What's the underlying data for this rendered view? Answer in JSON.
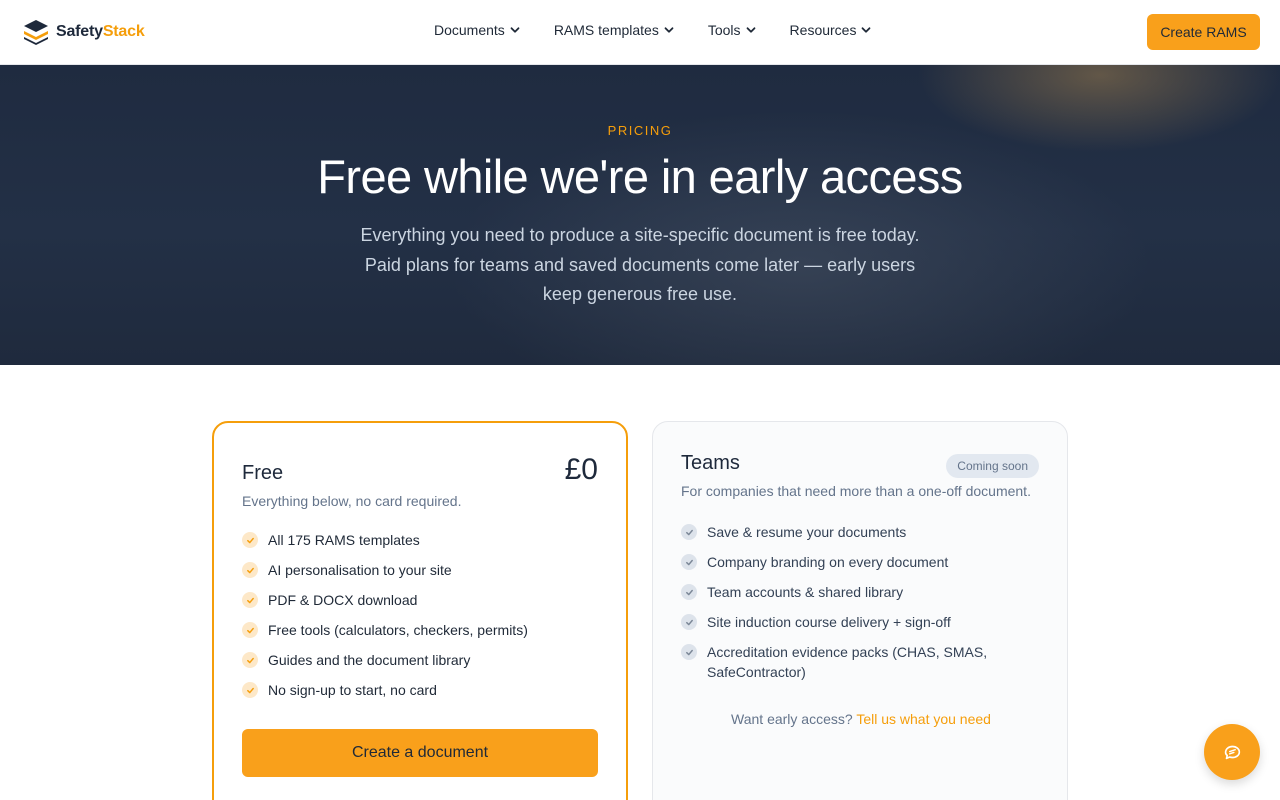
{
  "brand": {
    "name_part1": "Safety",
    "name_part2": "Stack"
  },
  "nav": {
    "items": [
      {
        "label": "Documents"
      },
      {
        "label": "RAMS templates"
      },
      {
        "label": "Tools"
      },
      {
        "label": "Resources"
      }
    ],
    "cta_label": "Create RAMS"
  },
  "hero": {
    "eyebrow": "PRICING",
    "title": "Free while we're in early access",
    "subtitle": "Everything you need to produce a site-specific document is free today. Paid plans for teams and saved documents come later — early users keep generous free use."
  },
  "plans": {
    "free": {
      "name": "Free",
      "price": "£0",
      "description": "Everything below, no card required.",
      "features": [
        "All 175 RAMS templates",
        "AI personalisation to your site",
        "PDF & DOCX download",
        "Free tools (calculators, checkers, permits)",
        "Guides and the document library",
        "No sign-up to start, no card"
      ],
      "button_label": "Create a document"
    },
    "teams": {
      "name": "Teams",
      "badge": "Coming soon",
      "description": "For companies that need more than a one-off document.",
      "features": [
        "Save & resume your documents",
        "Company branding on every document",
        "Team accounts & shared library",
        "Site induction course delivery + sign-off",
        "Accreditation evidence packs (CHAS, SMAS, SafeContractor)"
      ],
      "early_access_text": "Want early access?",
      "early_access_link": "Tell us what you need"
    }
  },
  "colors": {
    "accent": "#f9a01b",
    "hero_bg": "#1f2b40",
    "text_dark": "#1e293b",
    "text_muted": "#64748b"
  },
  "icons": {
    "logo": "stacked-layers-logo-icon",
    "nav_chevron": "chevron-down-icon",
    "feature_check": "check-icon",
    "chat": "chat-bubbles-icon"
  }
}
